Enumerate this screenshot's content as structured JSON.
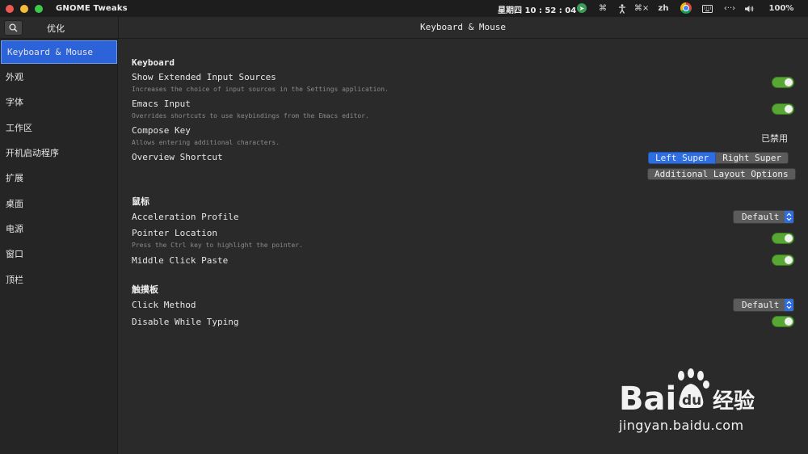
{
  "topbar": {
    "app_title": "GNOME Tweaks",
    "clock": "星期四 10 : 52 : 04",
    "language": "zh",
    "battery": "100%",
    "icons": [
      "send-icon",
      "command-icon",
      "accessibility-icon",
      "command-alt-icon",
      "chrome-icon",
      "keyboard-icon",
      "network-icon",
      "volume-icon"
    ]
  },
  "header": {
    "sidebar_title": "优化",
    "main_title": "Keyboard & Mouse"
  },
  "sidebar": {
    "items": [
      {
        "label": "Keyboard & Mouse",
        "selected": true
      },
      {
        "label": "外观"
      },
      {
        "label": "字体"
      },
      {
        "label": "工作区"
      },
      {
        "label": "开机启动程序"
      },
      {
        "label": "扩展"
      },
      {
        "label": "桌面"
      },
      {
        "label": "电源"
      },
      {
        "label": "窗口"
      },
      {
        "label": "顶栏"
      }
    ]
  },
  "keyboard": {
    "heading": "Keyboard",
    "extended_input": {
      "label": "Show Extended Input Sources",
      "desc": "Increases the choice of input sources in the Settings application.",
      "enabled": true
    },
    "emacs_input": {
      "label": "Emacs Input",
      "desc": "Overrides shortcuts to use keybindings from the Emacs editor.",
      "enabled": true
    },
    "compose_key": {
      "label": "Compose Key",
      "desc": "Allows entering additional characters.",
      "value": "已禁用"
    },
    "overview_shortcut": {
      "label": "Overview Shortcut",
      "options": [
        "Left Super",
        "Right Super"
      ],
      "selected": "Left Super",
      "additional_button": "Additional Layout Options"
    }
  },
  "mouse": {
    "heading": "鼠标",
    "acceleration_profile": {
      "label": "Acceleration Profile",
      "value": "Default"
    },
    "pointer_location": {
      "label": "Pointer Location",
      "desc": "Press the Ctrl key to highlight the pointer.",
      "enabled": true
    },
    "middle_click_paste": {
      "label": "Middle Click Paste",
      "enabled": true
    }
  },
  "touchpad": {
    "heading": "触摸板",
    "click_method": {
      "label": "Click Method",
      "value": "Default"
    },
    "disable_while_typing": {
      "label": "Disable While Typing",
      "enabled": true
    }
  },
  "watermark": {
    "url": "jingyan.baidu.com"
  },
  "colors": {
    "accent": "#2f6ee0",
    "switch_on": "#58a634",
    "background": "#2a2a2a",
    "sidebar": "#252525"
  }
}
